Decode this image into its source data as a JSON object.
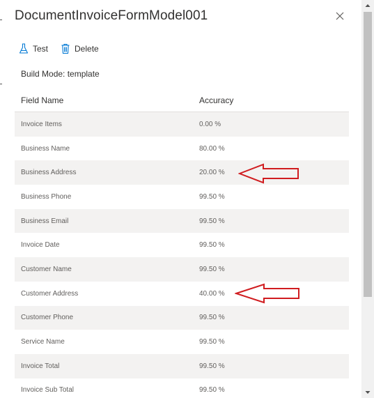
{
  "header": {
    "title": "DocumentInvoiceFormModel001"
  },
  "toolbar": {
    "test_label": "Test",
    "delete_label": "Delete"
  },
  "build_mode": "Build Mode: template",
  "table": {
    "columns": [
      "Field Name",
      "Accuracy"
    ],
    "rows": [
      {
        "field": "Invoice Items",
        "accuracy": "0.00 %"
      },
      {
        "field": "Business Name",
        "accuracy": "80.00 %"
      },
      {
        "field": "Business Address",
        "accuracy": "20.00 %"
      },
      {
        "field": "Business Phone",
        "accuracy": "99.50 %"
      },
      {
        "field": "Business Email",
        "accuracy": "99.50 %"
      },
      {
        "field": "Invoice Date",
        "accuracy": "99.50 %"
      },
      {
        "field": "Customer Name",
        "accuracy": "99.50 %"
      },
      {
        "field": "Customer Address",
        "accuracy": "40.00 %"
      },
      {
        "field": "Customer Phone",
        "accuracy": "99.50 %"
      },
      {
        "field": "Service Name",
        "accuracy": "99.50 %"
      },
      {
        "field": "Invoice Total",
        "accuracy": "99.50 %"
      },
      {
        "field": "Invoice Sub Total",
        "accuracy": "99.50 %"
      }
    ]
  },
  "icons": {
    "close": "close-icon",
    "test": "flask-icon",
    "delete": "trash-icon",
    "annotation_arrow": "left-arrow-icon"
  },
  "colors": {
    "accent": "#0078d4",
    "annotation": "#d01c1f",
    "row_alt": "#f3f2f1"
  }
}
